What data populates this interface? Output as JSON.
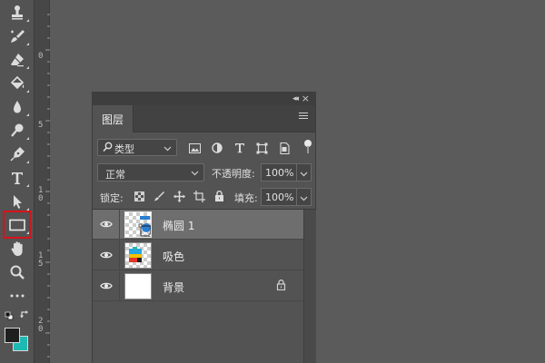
{
  "toolbar": {
    "tools": [
      {
        "name": "stamp-tool",
        "icon": "stamp-icon"
      },
      {
        "name": "history-brush-tool",
        "icon": "history-brush-icon"
      },
      {
        "name": "eraser-tool",
        "icon": "eraser-icon"
      },
      {
        "name": "paint-bucket-tool",
        "icon": "paint-bucket-icon"
      },
      {
        "name": "blur-tool",
        "icon": "drop-icon"
      },
      {
        "name": "dodge-tool",
        "icon": "dodge-icon"
      },
      {
        "name": "pen-tool",
        "icon": "pen-icon"
      },
      {
        "name": "type-tool",
        "icon": "type-icon"
      },
      {
        "name": "path-selection-tool",
        "icon": "arrow-icon"
      },
      {
        "name": "rectangle-tool",
        "icon": "rectangle-icon",
        "selected": true
      },
      {
        "name": "hand-tool",
        "icon": "hand-icon"
      },
      {
        "name": "zoom-tool",
        "icon": "zoom-icon"
      },
      {
        "name": "more-tools",
        "icon": "ellipsis-icon"
      }
    ],
    "foreground_color": "#1f1f1f",
    "background_color": "#1fb9b4",
    "highlight_color": "#d8121a"
  },
  "ruler": {
    "marks": [
      "0",
      "5",
      "1\n0",
      "1\n5",
      "2\n0"
    ]
  },
  "layers_panel": {
    "tab_label": "图层",
    "filter": {
      "kind_label": "类型"
    },
    "blend_mode": "正常",
    "opacity_label": "不透明度:",
    "opacity_value": "100%",
    "lock_label": "锁定:",
    "fill_label": "填充:",
    "fill_value": "100%",
    "layers": [
      {
        "name": "椭圆 1",
        "selected": true,
        "visible": true
      },
      {
        "name": "吸色",
        "selected": false,
        "visible": true
      },
      {
        "name": "背景",
        "selected": false,
        "visible": true,
        "locked": true
      }
    ]
  }
}
